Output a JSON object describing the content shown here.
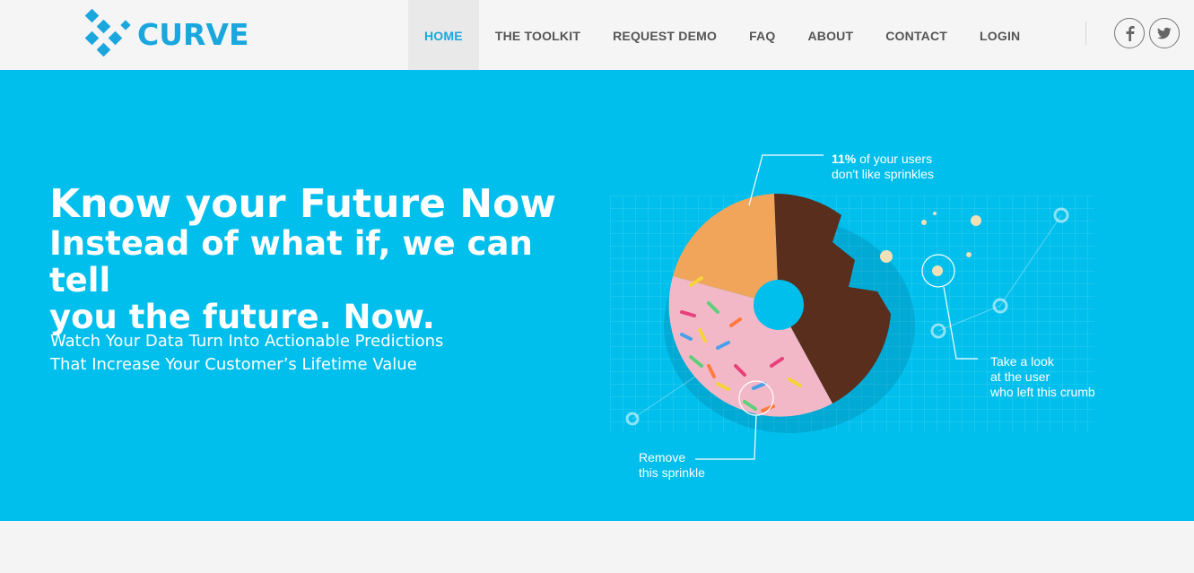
{
  "brand": {
    "name": "CURVE",
    "accent": "#1aa7de"
  },
  "nav": {
    "items": [
      {
        "label": "HOME",
        "active": true
      },
      {
        "label": "THE TOOLKIT"
      },
      {
        "label": "REQUEST DEMO"
      },
      {
        "label": "FAQ"
      },
      {
        "label": "ABOUT"
      },
      {
        "label": "CONTACT"
      },
      {
        "label": "LOGIN"
      }
    ]
  },
  "social": {
    "facebook_icon": "facebook-icon",
    "twitter_icon": "twitter-icon"
  },
  "hero": {
    "bg_color": "#00bfec",
    "title_line1": "Know your Future Now",
    "title_line2": "Instead of what if, we can tell",
    "title_line3": "you the future. Now.",
    "sub_line1": "Watch Your Data Turn Into Actionable Predictions",
    "sub_line2": "That Increase Your Customer’s Lifetime Value"
  },
  "annotations": {
    "top_bold": "11%",
    "top_rest": " of your users",
    "top_line2": "don't like sprinkles",
    "right_line1": "Take a look",
    "right_line2": "at the user",
    "right_line3": "who left this crumb",
    "bottom_line1": "Remove",
    "bottom_line2": "this sprinkle"
  }
}
